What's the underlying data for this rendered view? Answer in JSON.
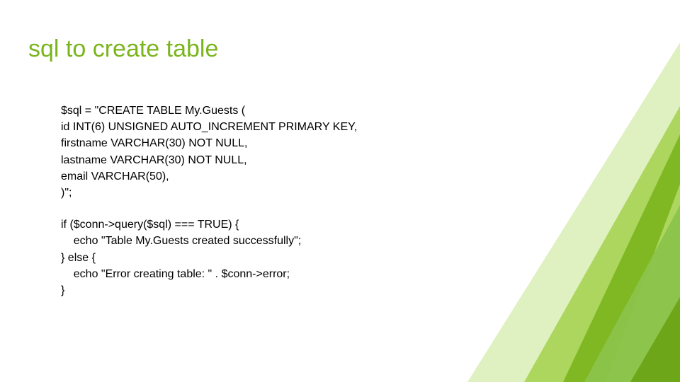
{
  "title": "sql to create table",
  "code": {
    "block1": {
      "l1": "$sql = \"CREATE TABLE My.Guests (",
      "l2": "id INT(6) UNSIGNED AUTO_INCREMENT PRIMARY KEY,",
      "l3": "firstname VARCHAR(30) NOT NULL,",
      "l4": "lastname VARCHAR(30) NOT NULL,",
      "l5": "email VARCHAR(50),",
      "l6": ")\";"
    },
    "block2": {
      "l1": "if ($conn->query($sql) === TRUE) {",
      "l2": "    echo \"Table My.Guests created successfully\";",
      "l3": "} else {",
      "l4": "    echo \"Error creating table: \" . $conn->error;",
      "l5": "}"
    }
  }
}
